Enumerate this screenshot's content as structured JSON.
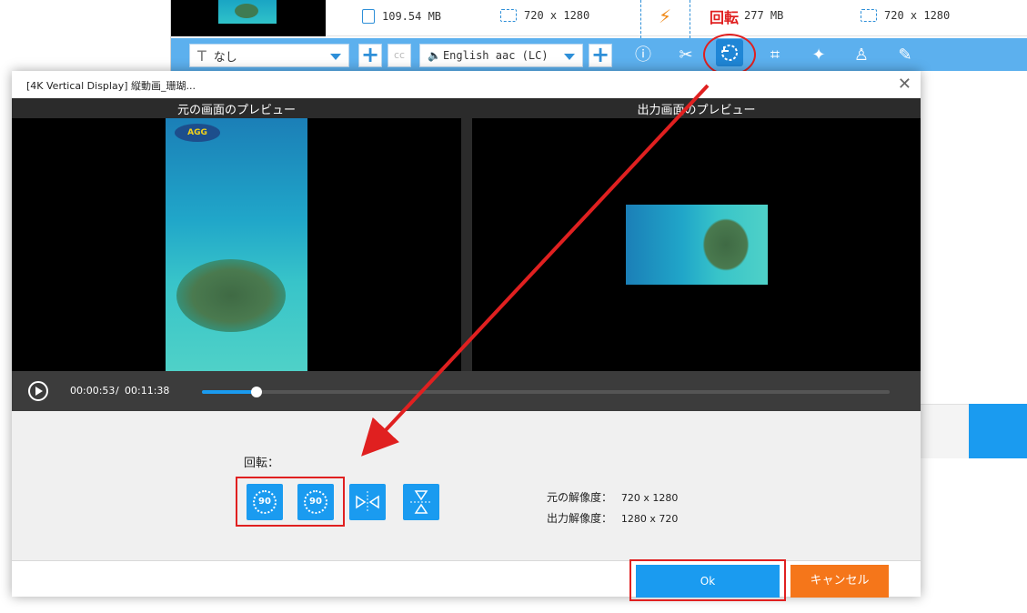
{
  "background_app": {
    "file_size": "109.54 MB",
    "source_resolution": "720 x 1280",
    "output_size": "277 MB",
    "output_resolution": "720 x 1280",
    "toolbar": {
      "subtitle_select": "なし",
      "audio_select": "English aac (LC)",
      "cc_label": "cc"
    }
  },
  "annotation": {
    "rotate_label": "回転"
  },
  "dialog": {
    "title": "[4K Vertical Display] 縦動画_珊瑚...",
    "close": "✕",
    "preview": {
      "left_header": "元の画面のプレビュー",
      "right_header": "出力画面のプレビュー",
      "logo_text": "AGG"
    },
    "player": {
      "current_time": "00:00:53",
      "separator": "/",
      "total_time": "00:11:38",
      "progress_fraction": 0.08
    },
    "rotation": {
      "label": "回転：",
      "rotate_left_label": "90",
      "rotate_right_label": "90",
      "original_resolution_label": "元の解像度：",
      "original_resolution_value": "720 x 1280",
      "output_resolution_label": "出力解像度：",
      "output_resolution_value": "1280 x 720"
    },
    "footer": {
      "ok": "Ok",
      "cancel": "キャンセル"
    }
  },
  "colors": {
    "accent": "#1a9bf0",
    "cancel": "#f5761a",
    "annotation": "#e02020"
  }
}
